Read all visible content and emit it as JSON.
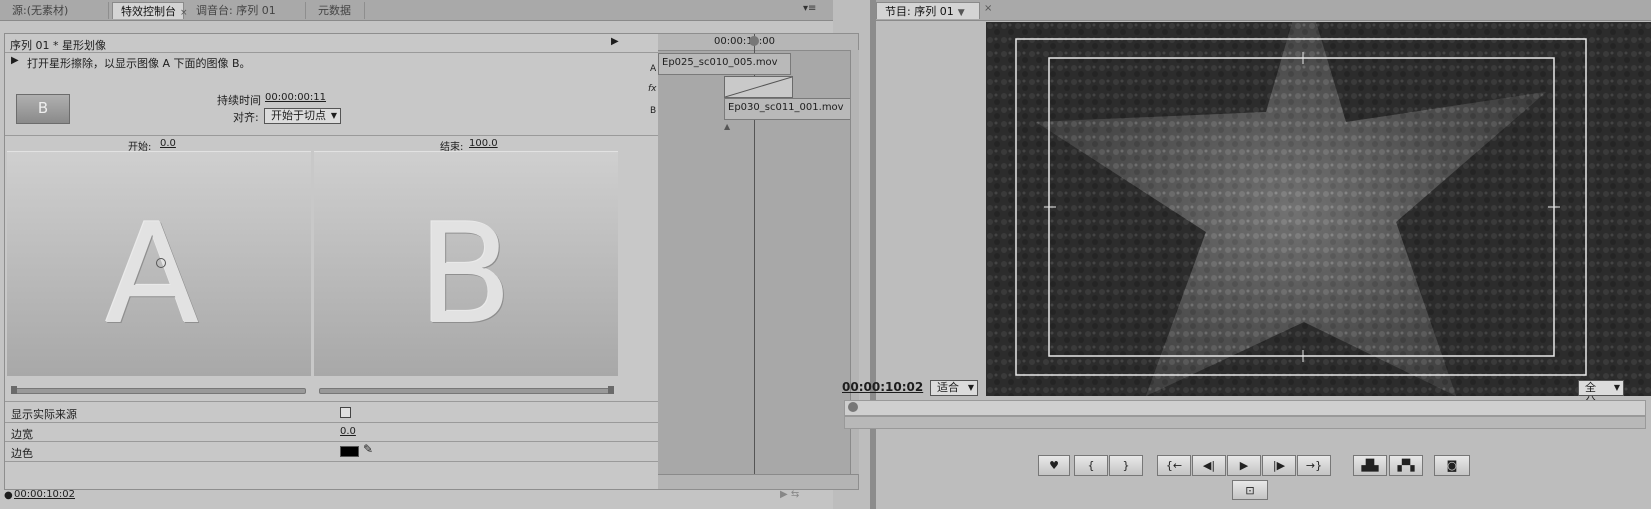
{
  "left_tabs": [
    {
      "label": "源:(无素材)",
      "active": false
    },
    {
      "label": "特效控制台",
      "active": true,
      "closable": true
    },
    {
      "label": "调音台: 序列 01",
      "active": false
    },
    {
      "label": "元数据",
      "active": false
    }
  ],
  "right_tabs": [
    {
      "label": "节目: 序列 01",
      "active": true
    }
  ],
  "effect_controls": {
    "header": "序列 01 * 星形划像",
    "description": "打开星形擦除，以显示图像 A 下面的图像 B。",
    "preview_letter": "B",
    "duration_label": "持续时间",
    "duration_value": "00:00:00:11",
    "align_label": "对齐:",
    "align_value": "开始于切点",
    "start_label": "开始:",
    "start_value": "0.0",
    "end_label": "结束:",
    "end_value": "100.0",
    "thumb_a": "A",
    "thumb_b": "B",
    "show_actual_sources_label": "显示实际来源",
    "border_width_label": "边宽",
    "border_width_value": "0.0",
    "border_color_label": "边色",
    "border_color_value": "#000000",
    "footer_time": "00:00:10:02"
  },
  "mini_timeline": {
    "time": "00:00:10:00",
    "track_a_label": "A",
    "track_fx_label": "fx",
    "track_b_label": "B",
    "clip_a": "Ep025_sc010_005.mov",
    "clip_b": "Ep030_sc011_001.mov"
  },
  "program_monitor": {
    "timecode": "00:00:10:02",
    "fit_dropdown": "适合",
    "quality_dropdown": "全分...",
    "buttons": [
      "♥",
      "{",
      "}",
      "{←",
      "◀|",
      "▶",
      "|▶",
      "→}",
      "lift",
      "extract",
      "camera"
    ],
    "bottom_button": "safe-margins"
  }
}
